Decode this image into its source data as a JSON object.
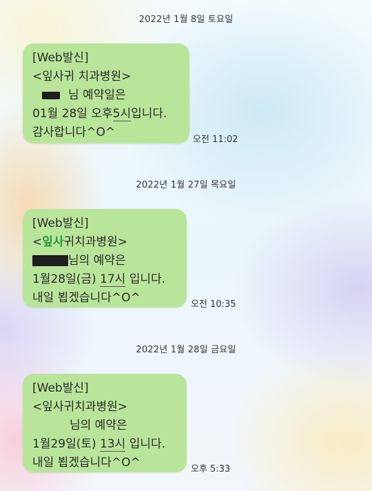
{
  "chat": {
    "messages": [
      {
        "date": "2022년 1월 8일 토요일",
        "lines": {
          "l1": "[Web발신]",
          "l2": "<잎사귀 치과병원>",
          "l3_suffix": "님 예약일은",
          "l4_pre": "01월 28일 오후",
          "l4_ul": "5시",
          "l4_post": "입니다.",
          "l5": "감사합니다^O^"
        },
        "time": "오전 11:02"
      },
      {
        "date": "2022년 1월 27일 목요일",
        "lines": {
          "l1": "[Web발신]",
          "l2_open": "<",
          "l2_hl": "잎사",
          "l2_rest": "귀치과병원>",
          "l3_suffix": "님의 예약은",
          "l4_pre": "1월28일(금) ",
          "l4_ul": "17시",
          "l4_post": " 입니다.",
          "l5": "내일 뵙겠습니다^O^"
        },
        "time": "오전 10:35"
      },
      {
        "date": "2022년 1월 28일 금요일",
        "lines": {
          "l1": "[Web발신]",
          "l2": "<잎사귀치과병원>",
          "l3_suffix": "님의 예약은",
          "l4_pre": "1월29일(토) ",
          "l4_ul": "13시",
          "l4_post": " 입니다.",
          "l5": "내일 뵙겠습니다^O^"
        },
        "time": "오후 5:33"
      }
    ]
  }
}
